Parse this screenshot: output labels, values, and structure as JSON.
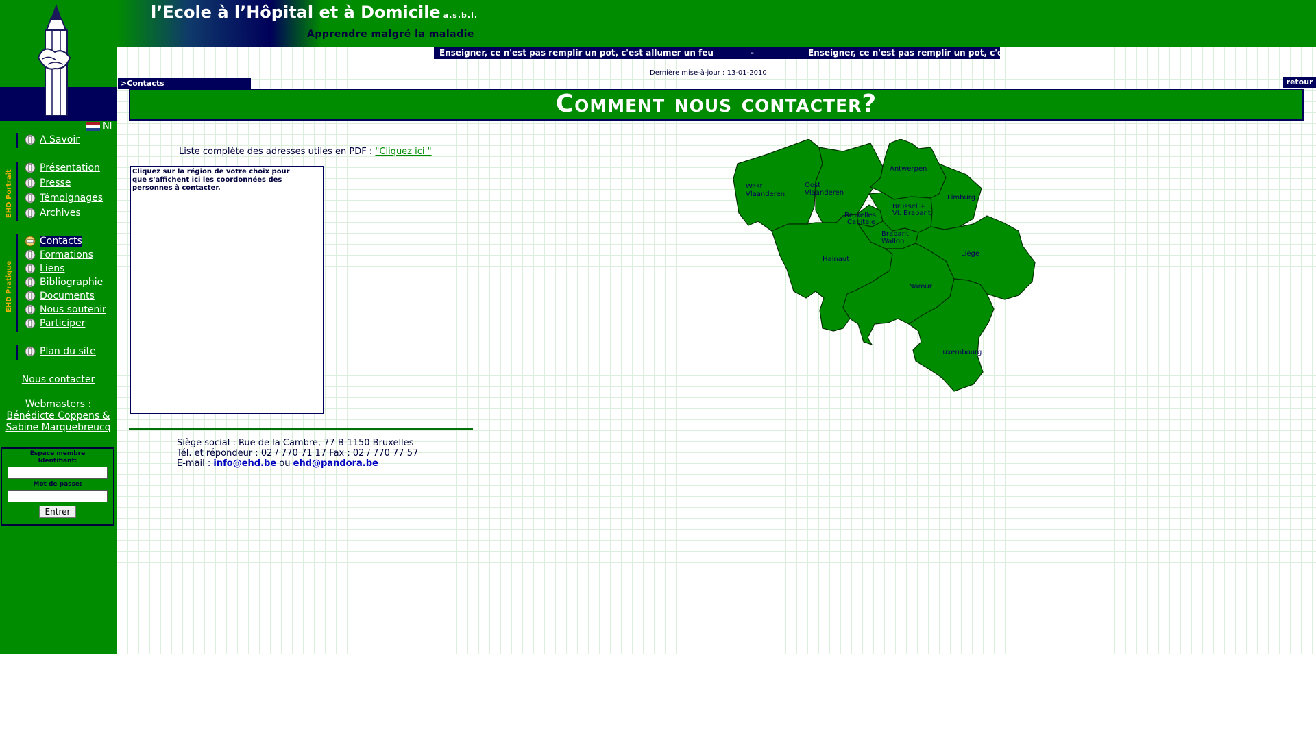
{
  "header": {
    "site_title": "l’Ecole à l’Hôpital et à Domicile",
    "asbl": "a.s.b.l.",
    "tagline": "Apprendre malgré la maladie"
  },
  "marquee": {
    "text_1": "Enseigner, ce n'est pas remplir un pot, c'est allumer un feu",
    "separator": "-",
    "text_2": "Enseigner, ce n'est pas remplir un pot, c'e"
  },
  "main": {
    "last_update": "Dernière mise-à-jour : 13-01-2010",
    "breadcrumb": ">Contacts",
    "back_label": "retour",
    "heading": "Comment nous contacter?",
    "pdf_prefix": "Liste complète des adresses utiles en PDF : ",
    "pdf_link": "\"Cliquez ici \"",
    "contact_box_text": "Cliquez sur la région de votre choix pour que s'affichent ici les coordonnées des personnes à contacter.",
    "map_regions": {
      "west_1": "West",
      "west_2": "Vlaanderen",
      "oost_1": "Oost",
      "oost_2": "Vlaanderen",
      "antwerpen": "Antwerpen",
      "limburg": "Limburg",
      "brussel_1": "Brussel +",
      "brussel_2": "Vl. Brabant",
      "bruxelles_1": "Bruxelles",
      "bruxelles_2": "Capitale",
      "brabant_1": "Brabant",
      "brabant_2": "Wallon",
      "hainaut": "Hainaut",
      "liege": "Liège",
      "namur": "Namur",
      "luxembourg": "Luxembourg"
    },
    "address": {
      "line1": "Siège social : Rue de la Cambre, 77  B-1150 Bruxelles",
      "line2": "Tél. et répondeur : 02 / 770 71 17   Fax : 02 / 770 77 57",
      "email_prefix": "E-mail : ",
      "email1": "info@ehd.be",
      "or": " ou ",
      "email2": "ehd@pandora.be"
    }
  },
  "sidebar": {
    "lang_link": "Nl",
    "section_portrait": "EHD  Portrait",
    "section_pratique": "EHD  Pratique",
    "items_top": [
      "A Savoir"
    ],
    "items_portrait": [
      "Présentation",
      "Presse",
      "Témoignages",
      "Archives"
    ],
    "items_pratique": [
      "Contacts",
      "Formations",
      "Liens",
      "Bibliographie",
      "Documents",
      "Nous soutenir",
      "Participer"
    ],
    "items_bottom": [
      "Plan du site"
    ],
    "contact_link": "Nous contacter",
    "webmasters_label": "Webmasters :",
    "webmasters_names_1": "Bénédicte Coppens &",
    "webmasters_names_2": "Sabine Marquebreucq",
    "member": {
      "title": "Espace membre",
      "id_label": "Identifiant:",
      "pw_label": "Mot de passe:",
      "submit": "Entrer"
    }
  },
  "colors": {
    "green": "#008c00",
    "navy": "#00005a",
    "gold": "#e7b007"
  }
}
